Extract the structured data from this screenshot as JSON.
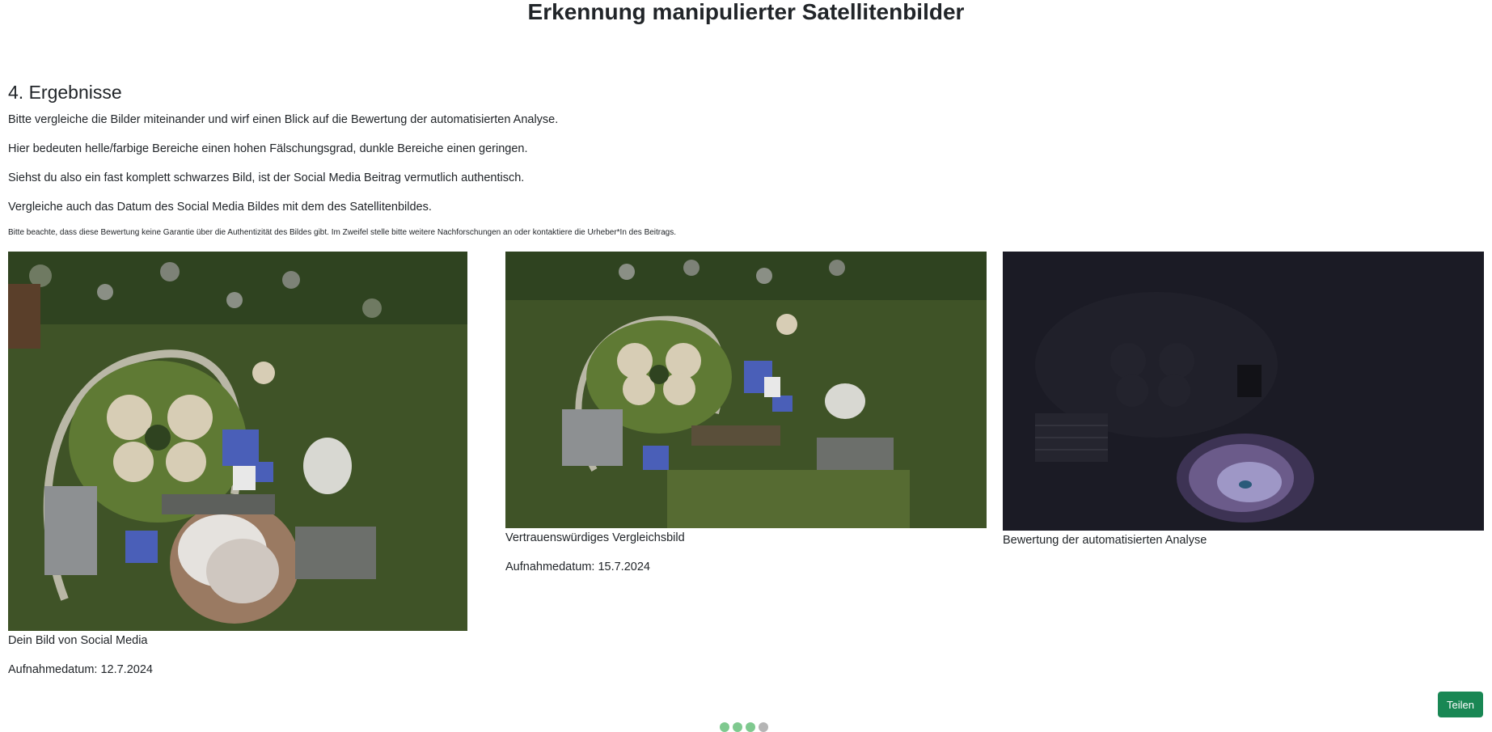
{
  "page": {
    "title": "Erkennung manipulierter Satellitenbilder"
  },
  "section": {
    "heading": "4. Ergebnisse",
    "paragraphs": [
      "Bitte vergleiche die Bilder miteinander und wirf einen Blick auf die Bewertung der automatisierten Analyse.",
      "Hier bedeuten helle/farbige Bereiche einen hohen Fälschungsgrad, dunkle Bereiche einen geringen.",
      "Siehst du also ein fast komplett schwarzes Bild, ist der Social Media Beitrag vermutlich authentisch.",
      "Vergleiche auch das Datum des Social Media Bildes mit dem des Satellitenbildes."
    ],
    "note": "Bitte beachte, dass diese Bewertung keine Garantie über die Authentizität des Bildes gibt. Im Zweifel stelle bitte weitere Nachforschungen an oder kontaktiere die Urheber*In des Beitrags."
  },
  "images": {
    "social": {
      "caption": "Dein Bild von Social Media",
      "date": "Aufnahmedatum: 12.7.2024"
    },
    "reference": {
      "caption": "Vertrauenswürdiges Vergleichsbild",
      "date": "Aufnahmedatum: 15.7.2024"
    },
    "analysis": {
      "caption": "Bewertung der automatisierten Analyse"
    }
  },
  "actions": {
    "share_label": "Teilen"
  },
  "progress": {
    "total_steps": 4,
    "completed_steps": 3,
    "colors": {
      "done": "#7fc98f",
      "pending": "#b5b5b5"
    }
  },
  "colors": {
    "accent": "#198754"
  }
}
